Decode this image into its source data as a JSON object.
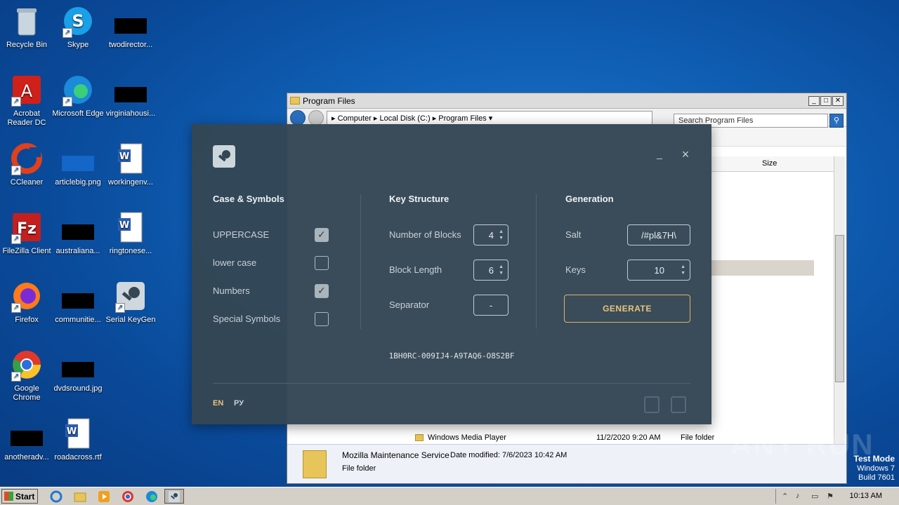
{
  "desktop": {
    "icons": [
      {
        "label": "Recycle Bin"
      },
      {
        "label": "Skype"
      },
      {
        "label": "twodirector..."
      },
      {
        "label": "Acrobat Reader DC"
      },
      {
        "label": "Microsoft Edge"
      },
      {
        "label": "virginiahousi..."
      },
      {
        "label": "CCleaner"
      },
      {
        "label": "articlebig.png"
      },
      {
        "label": "workingenv..."
      },
      {
        "label": "FileZilla Client"
      },
      {
        "label": "australiana..."
      },
      {
        "label": "ringtonese..."
      },
      {
        "label": "Firefox"
      },
      {
        "label": "communitie..."
      },
      {
        "label": "Serial KeyGen"
      },
      {
        "label": "Google Chrome"
      },
      {
        "label": "dvdsround.jpg"
      },
      {
        "label": "anotheradv..."
      },
      {
        "label": "roadacross.rtf"
      }
    ]
  },
  "explorer": {
    "title": "Program Files",
    "breadcrumb": "▸ Computer ▸ Local Disk (C:) ▸ Program Files ▾",
    "search_placeholder": "Search Program Files",
    "column_size": "Size",
    "visible_row": {
      "name": "Windows Media Player",
      "date": "11/2/2020 9:20 AM",
      "type": "File folder"
    },
    "details": {
      "name": "Mozilla Maintenance Service",
      "date_modified": "Date modified: 7/6/2023 10:42 AM",
      "type": "File folder"
    }
  },
  "keygen": {
    "minimize": "_",
    "close": "×",
    "sections": {
      "case": "Case & Symbols",
      "structure": "Key Structure",
      "generation": "Generation"
    },
    "options": [
      {
        "label": "UPPERCASE",
        "checked": true
      },
      {
        "label": "lower case",
        "checked": false
      },
      {
        "label": "Numbers",
        "checked": true
      },
      {
        "label": "Special Symbols",
        "checked": false
      }
    ],
    "structure": {
      "blocks_label": "Number of Blocks",
      "blocks_value": "4",
      "length_label": "Block Length",
      "length_value": "6",
      "separator_label": "Separator",
      "separator_value": "-"
    },
    "generation": {
      "salt_label": "Salt",
      "salt_value": "/#pl&7H\\",
      "keys_label": "Keys",
      "keys_value": "10",
      "generate_label": "GENERATE"
    },
    "result_key": "1BH0RC-009IJ4-A9TAQ6-O8S2BF",
    "lang_en": "EN",
    "lang_ru": "РУ"
  },
  "taskbar": {
    "start_label": "Start",
    "clock": "10:13 AM"
  },
  "watermark": "ANY RUN",
  "test_mode": {
    "line1": "Test Mode",
    "line2": "Windows 7",
    "line3": "Build 7601"
  },
  "colors": {
    "dialog_bg": "#344654",
    "accent_gold": "#d9b46a"
  }
}
